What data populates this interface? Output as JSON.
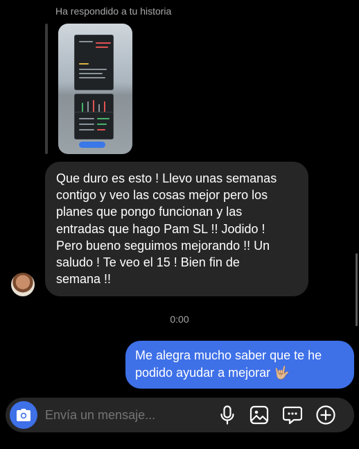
{
  "reply": {
    "label": "Ha respondido a tu historia"
  },
  "messages": {
    "incoming_text": "Que duro es esto ! Llevo unas semanas\ncontigo y veo las cosas mejor pero los\nplanes que pongo funcionan y las\nentradas que hago Pam SL !! Jodido !\nPero bueno seguimos mejorando !! Un\nsaludo ! Te veo el 15 ! Bien fin de\nsemana !!",
    "timestamp": "0:00",
    "outgoing_text": "Me alegra mucho saber que te he\npodido ayudar a mejorar 🤟🏼"
  },
  "composer": {
    "placeholder": "Envía un mensaje...",
    "icons": [
      "camera-icon",
      "microphone-icon",
      "image-icon",
      "sticker-icon",
      "plus-icon"
    ]
  },
  "colors": {
    "background": "#000000",
    "incoming_bubble": "#262626",
    "outgoing_bubble": "#3e70e8",
    "secondary_text": "#a8a8a8"
  }
}
